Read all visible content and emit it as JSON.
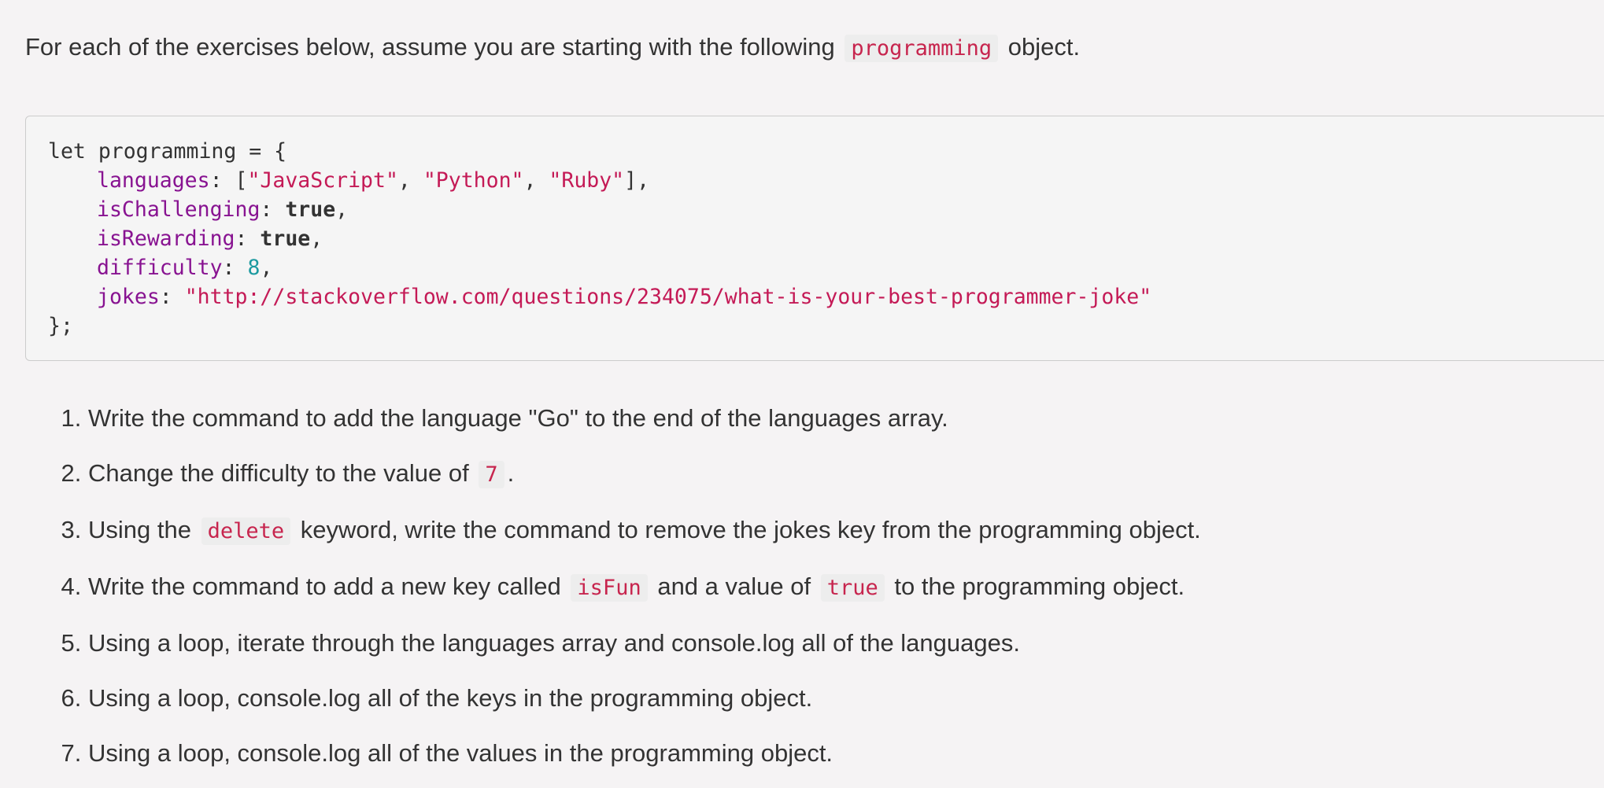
{
  "intro": {
    "before": "For each of the exercises below, assume you are starting with the following",
    "code": "programming",
    "after": "object."
  },
  "code_block": {
    "line1": "let programming = {",
    "languages_key": "languages",
    "languages_open": ": [",
    "lang1": "\"JavaScript\"",
    "lang2": "\"Python\"",
    "lang3": "\"Ruby\"",
    "languages_close": "],",
    "sep": ", ",
    "ischallenging_key": "isChallenging",
    "isrewarding_key": "isRewarding",
    "colon": ": ",
    "true_val": "true",
    "comma": ",",
    "difficulty_key": "difficulty",
    "difficulty_val": "8",
    "jokes_key": "jokes",
    "jokes_val": "\"http://stackoverflow.com/questions/234075/what-is-your-best-programmer-joke\"",
    "closing": "};"
  },
  "exercises": {
    "e1": "Write the command to add the language \"Go\" to the end of the languages array.",
    "e2_before": "Change the difficulty to the value of",
    "e2_code": "7",
    "e2_after": ".",
    "e3_before": "Using the",
    "e3_code": "delete",
    "e3_after": "keyword, write the command to remove the jokes key from the programming object.",
    "e4_before": "Write the command to add a new key called",
    "e4_code1": "isFun",
    "e4_mid": "and a value of",
    "e4_code2": "true",
    "e4_after": "to the programming object.",
    "e5": "Using a loop, iterate through the languages array and console.log all of the languages.",
    "e6": "Using a loop, console.log all of the keys in the programming object.",
    "e7": "Using a loop, console.log all of the values in the programming object."
  }
}
